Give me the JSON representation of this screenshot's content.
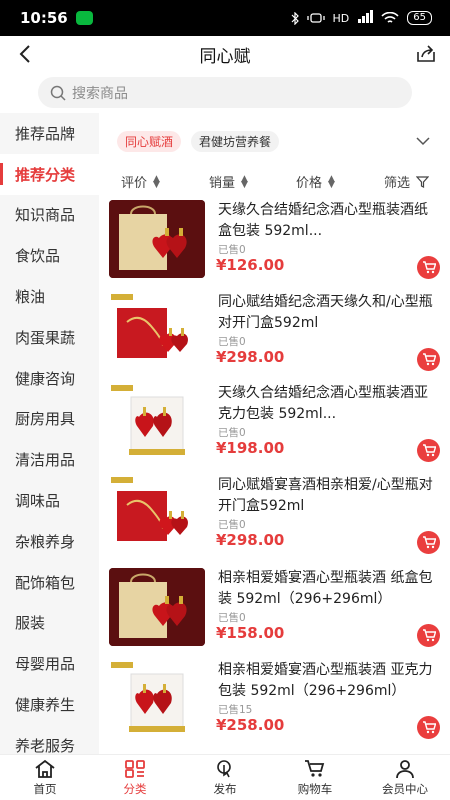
{
  "status_bar": {
    "time": "10:56",
    "network": "HD",
    "battery": "65"
  },
  "header": {
    "title": "同心赋"
  },
  "search": {
    "placeholder": "搜索商品"
  },
  "sidebar": {
    "items": [
      {
        "label": "推荐品牌"
      },
      {
        "label": "推荐分类",
        "active": true
      },
      {
        "label": "知识商品"
      },
      {
        "label": "食饮品"
      },
      {
        "label": "粮油"
      },
      {
        "label": "肉蛋果蔬"
      },
      {
        "label": "健康咨询"
      },
      {
        "label": "厨房用具"
      },
      {
        "label": "清洁用品"
      },
      {
        "label": "调味品"
      },
      {
        "label": "杂粮养身"
      },
      {
        "label": "配饰箱包"
      },
      {
        "label": "服装"
      },
      {
        "label": "母婴用品"
      },
      {
        "label": "健康养生"
      },
      {
        "label": "养老服务"
      }
    ]
  },
  "filter_chips": [
    {
      "label": "同心赋酒",
      "active": true
    },
    {
      "label": "君健坊营养餐",
      "active": false
    }
  ],
  "sort_bar": {
    "rating": "评价",
    "sales": "销量",
    "price": "价格",
    "filter": "筛选"
  },
  "products": [
    {
      "name": "天缘久合结婚纪念酒心型瓶装酒纸盒包装 592ml...",
      "sold": "已售0",
      "price": "¥126.00"
    },
    {
      "name": "同心赋结婚纪念酒天缘久和/心型瓶对开门盒592ml",
      "sold": "已售0",
      "price": "¥298.00"
    },
    {
      "name": "天缘久合结婚纪念酒心型瓶装酒亚克力包装 592ml...",
      "sold": "已售0",
      "price": "¥198.00"
    },
    {
      "name": "同心赋婚宴喜酒相亲相爱/心型瓶对开门盒592ml",
      "sold": "已售0",
      "price": "¥298.00"
    },
    {
      "name": "相亲相爱婚宴酒心型瓶装酒 纸盒包装 592ml（296+296ml）",
      "sold": "已售0",
      "price": "¥158.00"
    },
    {
      "name": "相亲相爱婚宴酒心型瓶装酒 亚克力包装 592ml（296+296ml）",
      "sold": "已售15",
      "price": "¥258.00"
    }
  ],
  "tab_bar": {
    "home": "首页",
    "category": "分类",
    "publish": "发布",
    "cart": "购物车",
    "member": "会员中心"
  },
  "colors": {
    "accent": "#e53c3c",
    "sidebar_bg": "#f6f6f6",
    "cart_button": "#ea3e3e"
  }
}
